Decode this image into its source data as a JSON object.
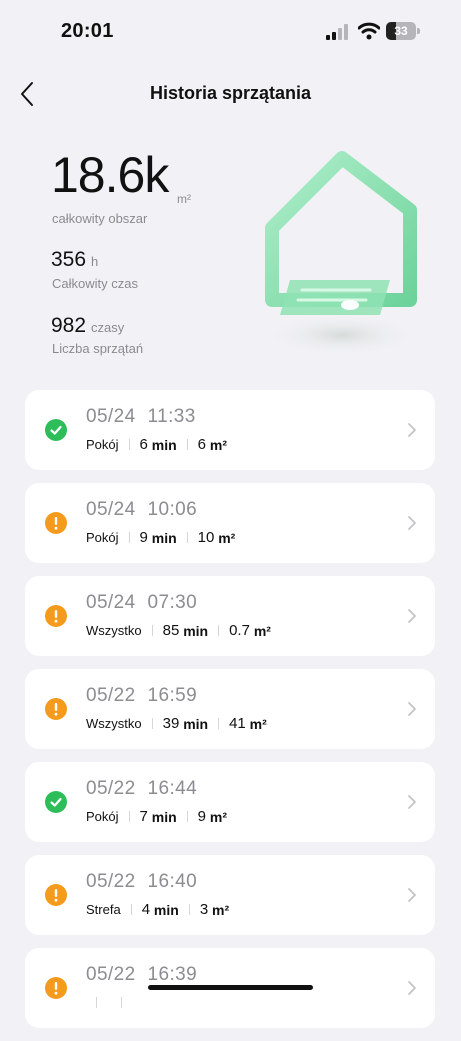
{
  "status_bar": {
    "time": "20:01",
    "battery": "33",
    "battery_level": 0.33
  },
  "header": {
    "title": "Historia sprzątania"
  },
  "stats": {
    "total_area": {
      "value": "18.6k",
      "unit": "m²",
      "label": "całkowity obszar"
    },
    "total_time": {
      "value": "356",
      "unit": "h",
      "label": "Całkowity czas"
    },
    "clean_count": {
      "value": "982",
      "unit": "czasy",
      "label": "Liczba sprzątań"
    }
  },
  "records": [
    {
      "date": "05/24",
      "time": "11:33",
      "status": "ok",
      "mode": "Pokój",
      "duration": "6",
      "duration_unit": "min",
      "area": "6",
      "area_unit": "m²"
    },
    {
      "date": "05/24",
      "time": "10:06",
      "status": "warn",
      "mode": "Pokój",
      "duration": "9",
      "duration_unit": "min",
      "area": "10",
      "area_unit": "m²"
    },
    {
      "date": "05/24",
      "time": "07:30",
      "status": "warn",
      "mode": "Wszystko",
      "duration": "85",
      "duration_unit": "min",
      "area": "0.7",
      "area_unit": "m²"
    },
    {
      "date": "05/22",
      "time": "16:59",
      "status": "warn",
      "mode": "Wszystko",
      "duration": "39",
      "duration_unit": "min",
      "area": "41",
      "area_unit": "m²"
    },
    {
      "date": "05/22",
      "time": "16:44",
      "status": "ok",
      "mode": "Pokój",
      "duration": "7",
      "duration_unit": "min",
      "area": "9",
      "area_unit": "m²"
    },
    {
      "date": "05/22",
      "time": "16:40",
      "status": "warn",
      "mode": "Strefa",
      "duration": "4",
      "duration_unit": "min",
      "area": "3",
      "area_unit": "m²"
    },
    {
      "date": "05/22",
      "time": "16:39",
      "status": "warn",
      "mode": "",
      "duration": "",
      "duration_unit": "",
      "area": "",
      "area_unit": ""
    }
  ],
  "colors": {
    "ok": "#2dbe5a",
    "warn": "#f49a1c",
    "house": "#7fdca8"
  },
  "icons": {
    "back": "chevron-left-icon",
    "row": "chevron-right-icon",
    "ok": "check-circle-icon",
    "warn": "exclamation-circle-icon"
  }
}
